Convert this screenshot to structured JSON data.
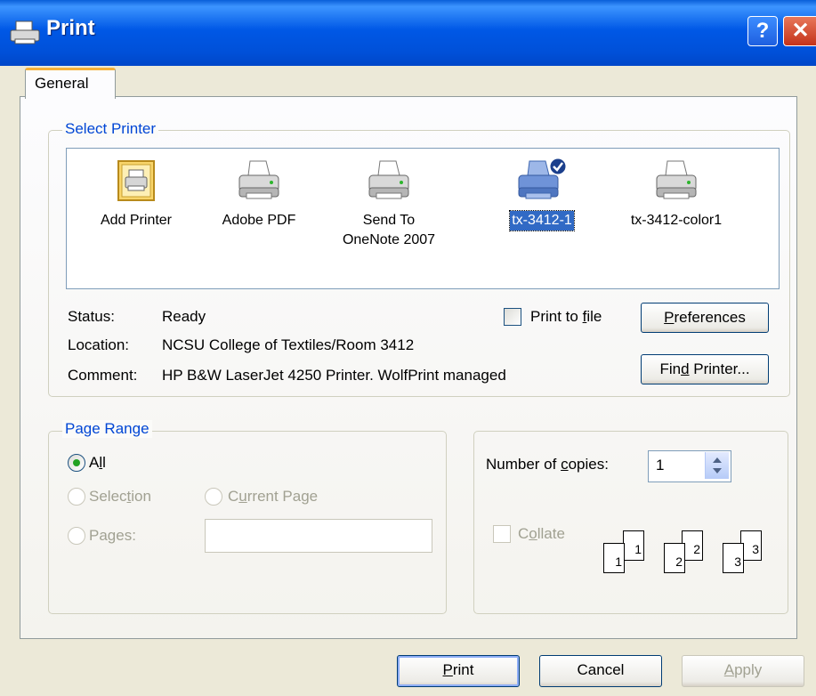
{
  "window": {
    "title": "Print",
    "help_label": "?",
    "close_label": "✕"
  },
  "tabs": [
    {
      "label": "General"
    }
  ],
  "select_printer": {
    "legend": "Select Printer",
    "printers": [
      {
        "line1": "Add Printer",
        "line2": "",
        "icon": "add-printer-icon"
      },
      {
        "line1": "Adobe PDF",
        "line2": "",
        "icon": "printer-icon"
      },
      {
        "line1": "Send To",
        "line2": "OneNote 2007",
        "icon": "printer-icon"
      },
      {
        "line1": "tx-3412-1",
        "line2": "",
        "icon": "default-printer-icon",
        "selected": true
      },
      {
        "line1": "tx-3412-color1",
        "line2": "",
        "icon": "printer-icon"
      }
    ],
    "status_label": "Status:",
    "status_value": "Ready",
    "location_label": "Location:",
    "location_value": "NCSU College of Textiles/Room 3412",
    "comment_label": "Comment:",
    "comment_value": "HP B&W LaserJet 4250 Printer.  WolfPrint managed",
    "print_to_file_pre": "Print to ",
    "print_to_file_u": "f",
    "print_to_file_post": "ile",
    "preferences_u": "P",
    "preferences_rest": "references",
    "find_printer_pre": "Fin",
    "find_printer_u": "d",
    "find_printer_post": " Printer..."
  },
  "page_range": {
    "legend": "Page Range",
    "all_pre": "A",
    "all_u": "l",
    "all_post": "l",
    "selection_pre": "Selec",
    "selection_u": "t",
    "selection_post": "ion",
    "current_page_pre": "C",
    "current_page_u": "u",
    "current_page_post": "rrent Page",
    "pages_pre": "Pa",
    "pages_u": "g",
    "pages_post": "es:",
    "pages_value": ""
  },
  "copies": {
    "label_pre": "Number of ",
    "label_u": "c",
    "label_post": "opies:",
    "value": "1",
    "collate_pre": "C",
    "collate_u": "o",
    "collate_post": "llate",
    "collate_sheets": [
      "1",
      "2",
      "3"
    ]
  },
  "footer": {
    "print_u": "P",
    "print_rest": "rint",
    "cancel": "Cancel",
    "apply_u": "A",
    "apply_rest": "pply"
  },
  "colors": {
    "title_bar": "#0058E6",
    "legend_text": "#0046D5",
    "selection": "#316AC5",
    "tab_accent": "#F4B13A"
  }
}
